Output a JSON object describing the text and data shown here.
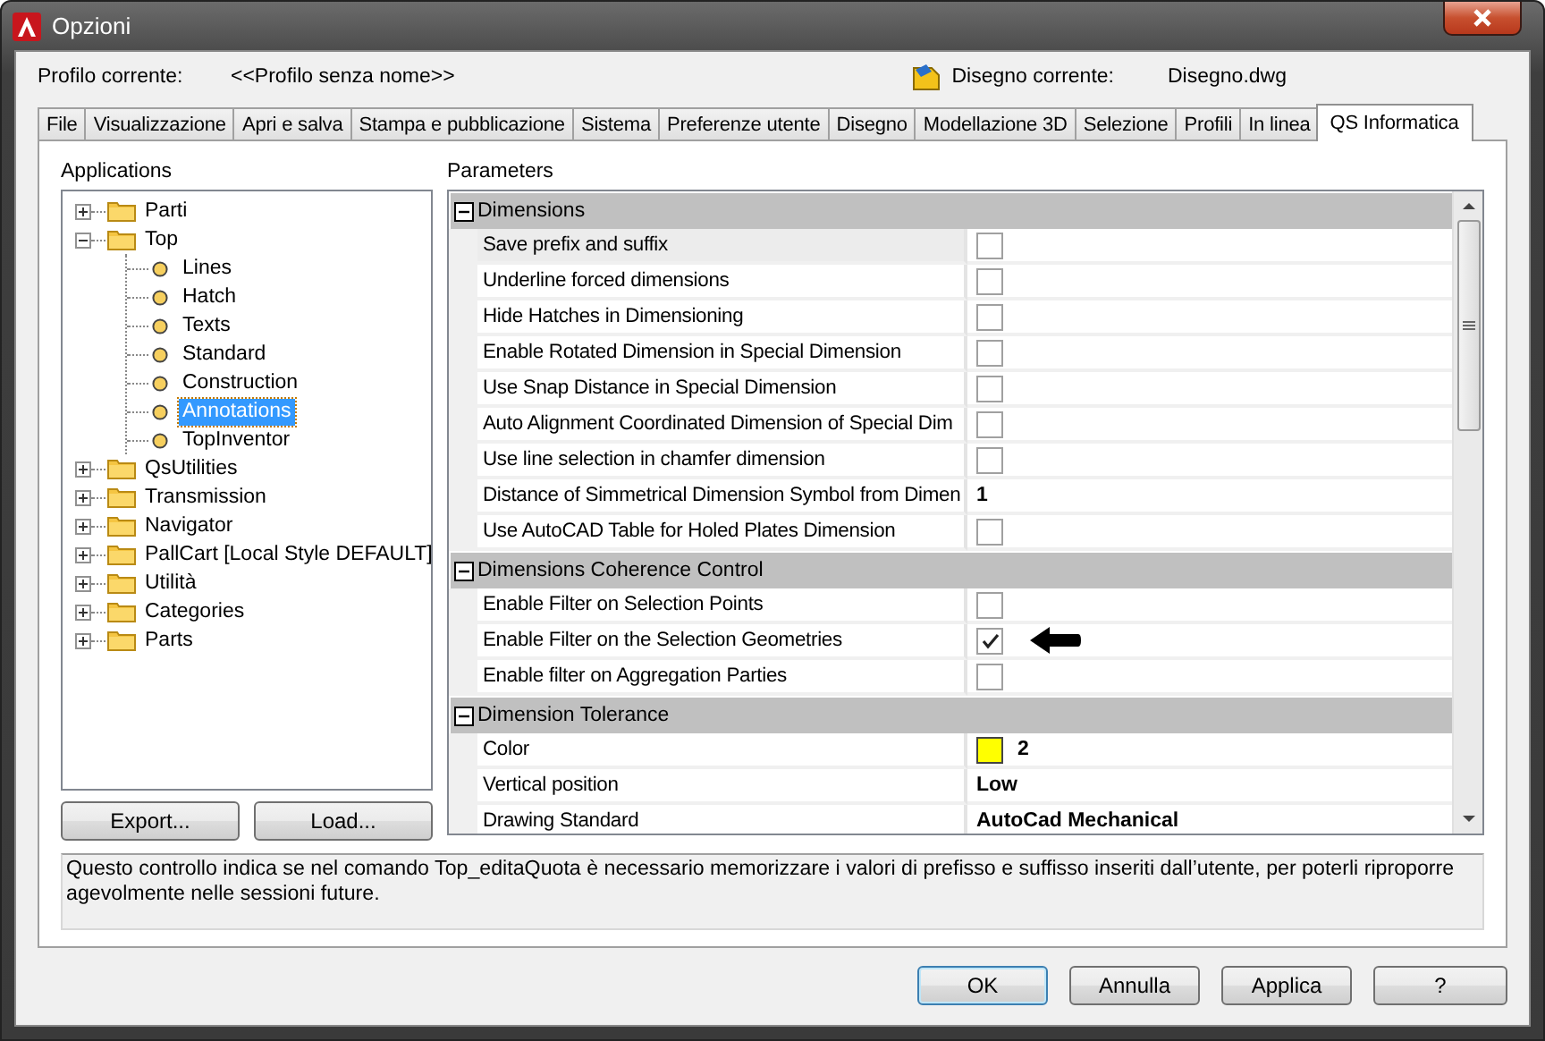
{
  "window": {
    "title": "Opzioni"
  },
  "profile": {
    "label": "Profilo corrente:",
    "value": "<<Profilo senza nome>>",
    "drawing_label": "Disegno corrente:",
    "drawing_value": "Disegno.dwg"
  },
  "tabs": [
    {
      "label": "File",
      "selected": false
    },
    {
      "label": "Visualizzazione",
      "selected": false
    },
    {
      "label": "Apri e salva",
      "selected": false
    },
    {
      "label": "Stampa e pubblicazione",
      "selected": false
    },
    {
      "label": "Sistema",
      "selected": false
    },
    {
      "label": "Preferenze utente",
      "selected": false
    },
    {
      "label": "Disegno",
      "selected": false
    },
    {
      "label": "Modellazione 3D",
      "selected": false
    },
    {
      "label": "Selezione",
      "selected": false
    },
    {
      "label": "Profili",
      "selected": false
    },
    {
      "label": "In linea",
      "selected": false
    },
    {
      "label": "QS Informatica",
      "selected": true
    }
  ],
  "applications": {
    "title": "Applications",
    "tree": [
      {
        "label": "Parti",
        "kind": "folder",
        "expanded": false,
        "selected": false
      },
      {
        "label": "Top",
        "kind": "folder",
        "expanded": true,
        "selected": false,
        "children": [
          {
            "label": "Lines",
            "kind": "leaf",
            "selected": false
          },
          {
            "label": "Hatch",
            "kind": "leaf",
            "selected": false
          },
          {
            "label": "Texts",
            "kind": "leaf",
            "selected": false
          },
          {
            "label": "Standard",
            "kind": "leaf",
            "selected": false
          },
          {
            "label": "Construction",
            "kind": "leaf",
            "selected": false
          },
          {
            "label": "Annotations",
            "kind": "leaf",
            "selected": true
          },
          {
            "label": "TopInventor",
            "kind": "leaf",
            "selected": false
          }
        ]
      },
      {
        "label": "QsUtilities",
        "kind": "folder",
        "expanded": false,
        "selected": false
      },
      {
        "label": "Transmission",
        "kind": "folder",
        "expanded": false,
        "selected": false
      },
      {
        "label": "Navigator",
        "kind": "folder",
        "expanded": false,
        "selected": false
      },
      {
        "label": "PallCart [Local Style DEFAULT]",
        "kind": "folder",
        "expanded": false,
        "selected": false
      },
      {
        "label": "Utilità",
        "kind": "folder",
        "expanded": false,
        "selected": false
      },
      {
        "label": "Categories",
        "kind": "folder",
        "expanded": false,
        "selected": false
      },
      {
        "label": "Parts",
        "kind": "folder",
        "expanded": false,
        "selected": false
      }
    ],
    "buttons": [
      "Export...",
      "Load..."
    ]
  },
  "parameters": {
    "title": "Parameters",
    "groups": [
      {
        "label": "Dimensions",
        "expanded": true,
        "items": [
          {
            "label": "Save prefix and suffix",
            "kind": "checkbox",
            "checked": false,
            "selected": true,
            "pointed": false
          },
          {
            "label": "Underline forced dimensions",
            "kind": "checkbox",
            "checked": false,
            "selected": false,
            "pointed": false
          },
          {
            "label": "Hide Hatches in Dimensioning",
            "kind": "checkbox",
            "checked": false,
            "selected": false,
            "pointed": false
          },
          {
            "label": "Enable Rotated Dimension in Special Dimension",
            "kind": "checkbox",
            "checked": false,
            "selected": false,
            "pointed": false
          },
          {
            "label": "Use Snap Distance in Special Dimension",
            "kind": "checkbox",
            "checked": false,
            "selected": false,
            "pointed": false
          },
          {
            "label": "Auto Alignment Coordinated Dimension of Special Dim",
            "kind": "checkbox",
            "checked": false,
            "selected": false,
            "pointed": false
          },
          {
            "label": "Use line selection in chamfer dimension",
            "kind": "checkbox",
            "checked": false,
            "selected": false,
            "pointed": false
          },
          {
            "label": "Distance of Simmetrical Dimension Symbol from Dimen",
            "kind": "text",
            "value": "1",
            "selected": false,
            "pointed": false
          },
          {
            "label": "Use AutoCAD Table for Holed Plates Dimension",
            "kind": "checkbox",
            "checked": false,
            "selected": false,
            "pointed": false
          }
        ]
      },
      {
        "label": "Dimensions Coherence Control",
        "expanded": true,
        "items": [
          {
            "label": "Enable Filter on Selection Points",
            "kind": "checkbox",
            "checked": false,
            "selected": false,
            "pointed": false
          },
          {
            "label": "Enable Filter on the Selection Geometries",
            "kind": "checkbox",
            "checked": true,
            "selected": false,
            "pointed": true
          },
          {
            "label": "Enable filter on Aggregation Parties",
            "kind": "checkbox",
            "checked": false,
            "selected": false,
            "pointed": false
          }
        ]
      },
      {
        "label": "Dimension Tolerance",
        "expanded": true,
        "items": [
          {
            "label": "Color",
            "kind": "color",
            "color": "#ffff00",
            "value": "2",
            "selected": false,
            "pointed": false
          },
          {
            "label": "Vertical position",
            "kind": "text",
            "value": "Low",
            "selected": false,
            "pointed": false
          },
          {
            "label": "Drawing Standard",
            "kind": "text",
            "value": "AutoCad Mechanical",
            "selected": false,
            "pointed": false
          }
        ]
      }
    ]
  },
  "description": "Questo controllo indica se nel comando Top_editaQuota è necessario memorizzare i valori di prefisso e suffisso inseriti dall’utente, per poterli riproporre agevolmente nelle sessioni future.",
  "buttons": [
    {
      "label": "OK",
      "kind": "default"
    },
    {
      "label": "Annulla",
      "kind": "normal"
    },
    {
      "label": "Applica",
      "kind": "normal"
    },
    {
      "label": "?",
      "kind": "help"
    }
  ]
}
